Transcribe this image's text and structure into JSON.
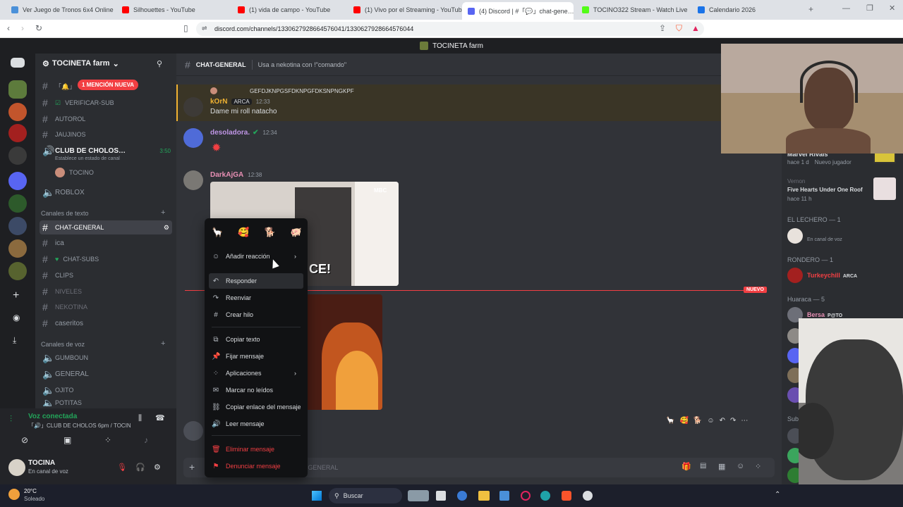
{
  "browser": {
    "tabs": [
      {
        "label": "Ver Juego de Tronos 6x4 Online Gra…",
        "color": "#4a90d9"
      },
      {
        "label": "Silhouettes - YouTube",
        "color": "#ff0000"
      },
      {
        "label": "(1) vida de campo - YouTube",
        "color": "#ff0000"
      },
      {
        "label": "(1) Vivo por el Streaming - YouTube",
        "color": "#ff0000"
      },
      {
        "label": "(4) Discord | #「💬」chat-gene…",
        "color": "#5865f2"
      },
      {
        "label": "TOCINO322 Stream - Watch Live",
        "color": "#53fc18"
      },
      {
        "label": "Calendario 2026",
        "color": "#1a73e8"
      }
    ],
    "url": "discord.com/channels/1330627928664576041/1330627928664576044"
  },
  "discord": {
    "window_title": "TOCINETA farm",
    "server_name": "TOCINETA farm",
    "mention_badge": "1 MENCIÓN NUEVA",
    "channels": {
      "verificar": "VERIFICAR-SUB",
      "autorol": "AUTOROL",
      "jaujinos": "JAUJINOS",
      "club": "CLUB DE CHOLOS…",
      "club_time": "3:50",
      "club_status": "Establece un estado de canal",
      "club_user": "TOCINO",
      "roblox": "ROBLOX",
      "text_cat": "Canales de texto",
      "chat_general": "CHAT-GENERAL",
      "ica": "ica",
      "chat_subs": "CHAT-SUBS",
      "clips": "CLIPS",
      "niveles": "NIVELES",
      "nekotina": "NEKOTINA",
      "caseritos": "caseritos",
      "voice_cat": "Canales de voz",
      "gumboun": "GUMBOUN",
      "general": "GENERAL",
      "ojito": "OJITO",
      "potitas": "POTITAS"
    },
    "voice_panel": {
      "title": "Voz conectada",
      "subtitle": "「🔊」CLUB DE CHOLOS 6pm / TOCIN…"
    },
    "user": {
      "name": "TOCINA",
      "status": "En canal de voz"
    },
    "header": {
      "channel": "CHAT-GENERAL",
      "topic": "Usa a nekotina con !\"comando\""
    },
    "messages": {
      "reply_snippet": "GEFDJKNPGSFDKNPGFDKSNPNGKPF",
      "m1_user": "kOrN",
      "m1_tag": "ARCA",
      "m1_time": "12:33",
      "m1_text": "Dame mi roll natacho",
      "m2_user": "desoladora.",
      "m2_time": "12:34",
      "m3_user": "DarkAjGA",
      "m3_time": "12:38",
      "gif_label": "CE!",
      "new_label": "NUEVO"
    },
    "context_menu": {
      "add_reaction": "Añadir reacción",
      "reply": "Responder",
      "forward": "Reenviar",
      "thread": "Crear hilo",
      "copy_text": "Copiar texto",
      "pin": "Fijar mensaje",
      "apps": "Aplicaciones",
      "mark_unread": "Marcar no leídos",
      "copy_link": "Copiar enlace del mensaje",
      "read": "Leer mensaje",
      "delete": "Eliminar mensaje",
      "report": "Denunciar mensaje"
    },
    "composer_placeholder": "Enviar mensaje a #「💬」CHAT-GENERAL",
    "composer_visible": "CHAT-GENERAL",
    "members": {
      "m1_name": "Marvel Rivals",
      "m1_meta": "hace 1 d",
      "m1_extra": "Nuevo jugador",
      "m2_label": "Vernon",
      "m2_title": "Five Hearts Under One Roof",
      "m2_meta": "hace 11 h",
      "group1": "EL LECHERO — 1",
      "g1_sub": "En canal de voz",
      "group2": "RONDERO — 1",
      "g2_name": "Turkeychill",
      "g2_tag": "ARCA",
      "group3": "Huaraca — 5",
      "g3_name": "Bersa",
      "g3_tag": "P@TO",
      "group4": "Sub"
    }
  },
  "taskbar": {
    "weather_temp": "20°C",
    "weather_desc": "Soleado",
    "search": "Buscar"
  },
  "colors": {
    "blurple": "#5865f2",
    "danger": "#f23f43",
    "online": "#23a55a"
  }
}
